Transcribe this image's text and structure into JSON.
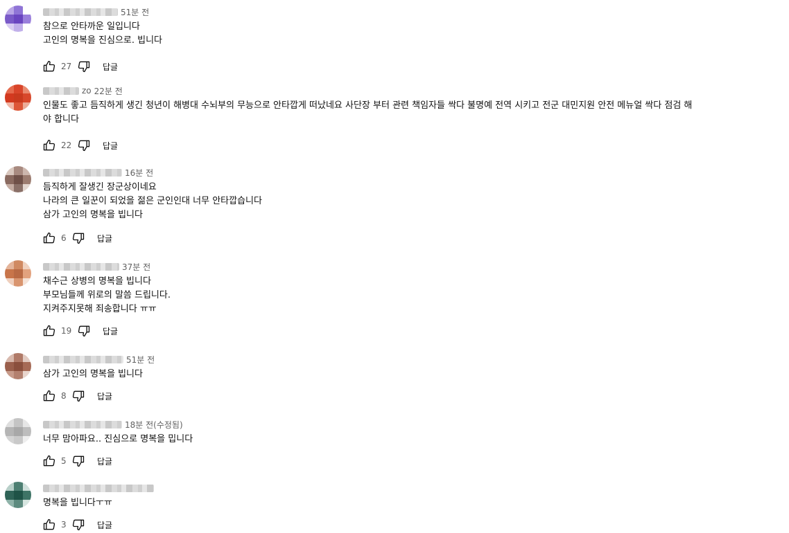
{
  "comments": [
    {
      "author_suffix": "",
      "time": "51분 전",
      "lines": [
        "참으로 안타까운 일입니다",
        "고인의 명복을 진심으로. 빕니다"
      ],
      "likes": "27",
      "reply": "답글",
      "avatar_colors": [
        "#b9a6e6",
        "#8f74d6",
        "#ffffff",
        "#7a5ac8",
        "#6a45c0",
        "#9a7fdc",
        "#d9cdf2",
        "#c1b0ea",
        "#ffffff"
      ]
    },
    {
      "author_suffix": "zo",
      "time": "22분 전",
      "lines": [
        "인물도 좋고 듬직하게 생긴 청년이 해병대 수뇌부의 무능으로 안타깝게 떠났네요 사단장 부터 관련 책임자들 싹다 불명예 전역 시키고 전군 대민지원 안전 메뉴얼 싹다 점검 해",
        "야 합니다"
      ],
      "likes": "22",
      "reply": "답글",
      "avatar_colors": [
        "#e56a4d",
        "#d9452a",
        "#e98a6f",
        "#d3391f",
        "#c93a1e",
        "#d8482b",
        "#f1b5a4",
        "#dd5637",
        "#ecac98"
      ]
    },
    {
      "author_suffix": "",
      "time": "16분 전",
      "lines": [
        "듬직하게 잘생긴 장군상이네요",
        "나라의 큰 일꾼이 되었을 젊은 군인인대 너무 안타깝습니다",
        "삼가 고인의 명복을 빕니다"
      ],
      "likes": "6",
      "reply": "답글",
      "avatar_colors": [
        "#d9c7be",
        "#a88a80",
        "#cdb7ae",
        "#8a6a60",
        "#6f5048",
        "#9c7c70",
        "#c4aca2",
        "#8a7068",
        "#e3d6cf"
      ]
    },
    {
      "author_suffix": "",
      "time": "37분 전",
      "lines": [
        "채수근 상병의 명복을 빕니다",
        "부모님들께 위로의 말씀 드립니다.",
        "지켜주지못해 죄송합니다 ㅠㅠ"
      ],
      "likes": "19",
      "reply": "답글",
      "avatar_colors": [
        "#e4b49a",
        "#d08a62",
        "#f0d2c0",
        "#c8754a",
        "#b96a44",
        "#e2a27e",
        "#efcfbd",
        "#d9956f",
        "#f5e3d8"
      ]
    },
    {
      "author_suffix": "",
      "time": "51분 전",
      "lines": [
        "삼가 고인의 명복을 빕니다"
      ],
      "likes": "8",
      "reply": "답글",
      "avatar_colors": [
        "#d8b9ad",
        "#b07a68",
        "#e2cbc2",
        "#9a5f4c",
        "#8a4f3d",
        "#a66a56",
        "#c79a8a",
        "#b3806f",
        "#e8d5cd"
      ]
    },
    {
      "author_suffix": "",
      "time": "18분 전(수정됨)",
      "lines": [
        "너무 맘아파요.. 진심으로 명복을 밉니다"
      ],
      "likes": "5",
      "reply": "답글",
      "avatar_colors": [
        "#dedede",
        "#c4c4c4",
        "#e6e6e6",
        "#b5b5b5",
        "#a8a8a8",
        "#bdbdbd",
        "#d4d4d4",
        "#c9c9c9",
        "#eeeeee"
      ]
    },
    {
      "author_suffix": "",
      "time": "",
      "lines": [
        "명복을 빕니다ㅜㅠ"
      ],
      "likes": "3",
      "reply": "답글",
      "avatar_colors": [
        "#b7cfc8",
        "#4d7f72",
        "#cfe0db",
        "#2f6357",
        "#1f5347",
        "#3e7466",
        "#8fb3a9",
        "#5d8b7f",
        "#d6e5e0"
      ]
    }
  ]
}
